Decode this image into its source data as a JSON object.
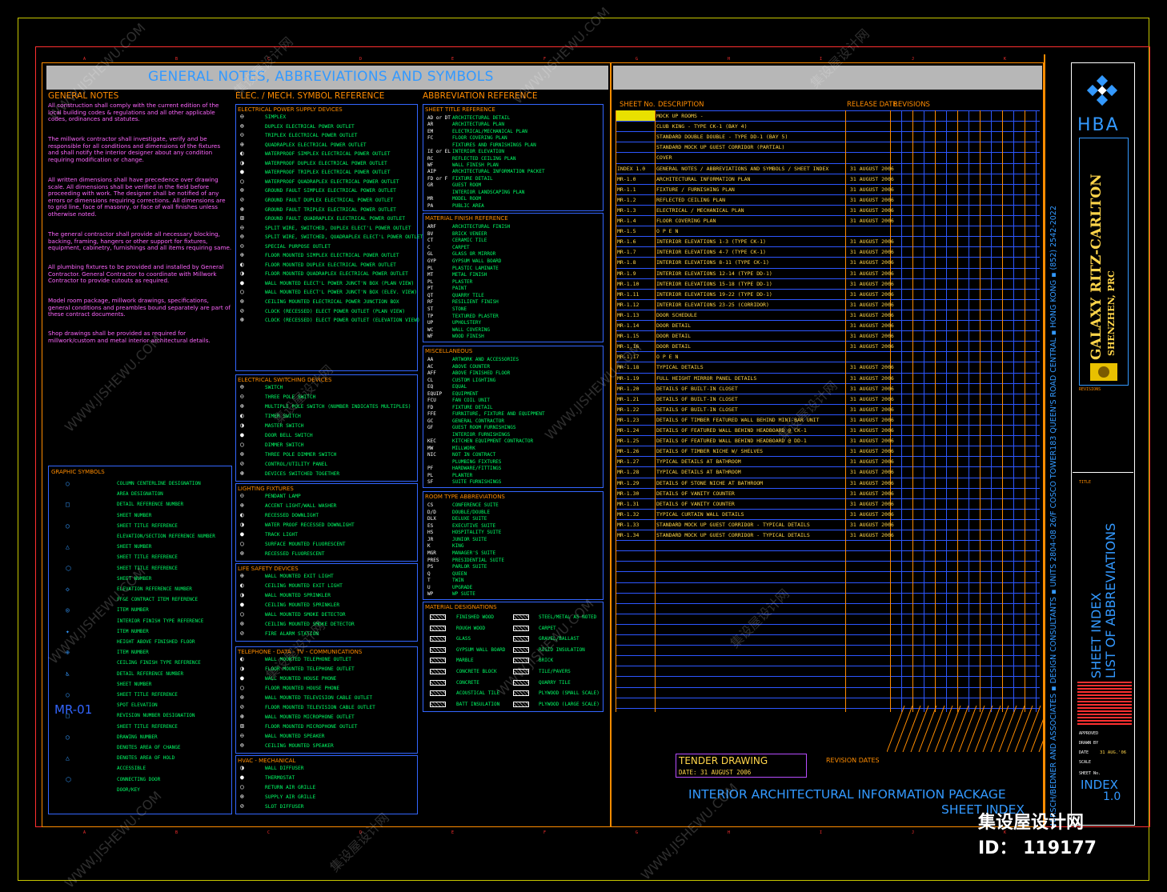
{
  "titles": {
    "main": "GENERAL NOTES, ABBREVIATIONS AND SYMBOLS",
    "general_notes": "GENERAL NOTES",
    "elec_mech": "ELEC. / MECH. SYMBOL REFERENCE",
    "abbrev": "ABBREVIATION REFERENCE",
    "graphic_symbols": "GRAPHIC SYMBOLS"
  },
  "general_notes": [
    "All construction shall comply with the current edition of the local building codes & regulations and all other applicable codes, ordinances and statutes.",
    "The millwork contractor shall investigate, verify and be responsible for all conditions and dimensions of the fixtures and shall notify the interior designer about any condition requiring modification or change.",
    "All written dimensions shall have precedence over drawing scale. All dimensions shall be verified in the field before proceeding with work. The designer shall be notified of any errors or dimensions requiring corrections. All dimensions are to grid line, face of masonry, or face of wall finishes unless otherwise noted.",
    "The general contractor shall provide all necessary blocking, backing, framing, hangers or other support for fixtures, equipment, cabinetry, furnishings and all items requiring same.",
    "All plumbing fixtures to be provided and installed by General Contractor. General Contractor to coordinate with Millwork Contractor to provide cutouts as required.",
    "Model room package, millwork drawings, specifications, general conditions and preambles bound separately are part of these contract documents.",
    "Shop drawings shall be provided as required for millwork/custom and metal interior architectural details."
  ],
  "elec_sections": [
    {
      "title": "ELECTRICAL POWER SUPPLY DEVICES",
      "items": [
        "SIMPLEX",
        "DUPLEX ELECTRICAL POWER OUTLET",
        "TRIPLEX ELECTRICAL POWER OUTLET",
        "QUADRAPLEX ELECTRICAL POWER OUTLET",
        "WATERPROOF SIMPLEX ELECTRICAL POWER OUTLET",
        "WATERPROOF DUPLEX ELECTRICAL POWER OUTLET",
        "WATERPROOF TRIPLEX ELECTRICAL POWER OUTLET",
        "WATERPROOF QUADRAPLEX ELECTRICAL POWER OUTLET",
        "GROUND FAULT SIMPLEX ELECTRICAL POWER OUTLET",
        "GROUND FAULT DUPLEX ELECTRICAL POWER OUTLET",
        "GROUND FAULT TRIPLEX ELECTRICAL POWER OUTLET",
        "GROUND FAULT QUADRAPLEX ELECTRICAL POWER OUTLET",
        "SPLIT WIRE, SWITCHED, DUPLEX ELECT'L POWER OUTLET",
        "SPLIT WIRE, SWITCHED, QUADRAPLEX ELECT'L POWER OUTLET",
        "SPECIAL PURPOSE OUTLET",
        "FLOOR MOUNTED SIMPLEX ELECTRICAL POWER OUTLET",
        "FLOOR MOUNTED DUPLEX ELECTRICAL POWER OUTLET",
        "FLOOR MOUNTED QUADRAPLEX ELECTRICAL POWER OUTLET",
        "WALL MOUNTED ELECT'L POWER JUNCT'N BOX (PLAN VIEW)",
        "WALL MOUNTED ELECT'L POWER JUNCT'N BOX (ELEV. VIEW)",
        "CEILING MOUNTED ELECTRICAL POWER JUNCTION BOX",
        "CLOCK (RECESSED) ELECT POWER OUTLET (PLAN VIEW)",
        "CLOCK (RECESSED) ELECT POWER OUTLET (ELEVATION VIEW)"
      ]
    },
    {
      "title": "ELECTRICAL SWITCHING DEVICES",
      "items": [
        "SWITCH",
        "THREE POLE SWITCH",
        "MULTIPLE POLE SWITCH (NUMBER INDICATES MULTIPLES)",
        "TIMER SWITCH",
        "MASTER SWITCH",
        "DOOR BELL SWITCH",
        "DIMMER SWITCH",
        "THREE POLE DIMMER SWITCH",
        "CONTROL/UTILITY PANEL",
        "DEVICES SWITCHED TOGETHER"
      ]
    },
    {
      "title": "LIGHTING FIXTURES",
      "items": [
        "PENDANT LAMP",
        "ACCENT LIGHT/WALL WASHER",
        "RECESSED DOWNLIGHT",
        "WATER PROOF RECESSED DOWNLIGHT",
        "TRACK LIGHT",
        "SURFACE MOUNTED FLUORESCENT",
        "RECESSED FLUORESCENT"
      ]
    },
    {
      "title": "LIFE SAFETY DEVICES",
      "items": [
        "WALL MOUNTED EXIT LIGHT",
        "CEILING MOUNTED EXIT LIGHT",
        "WALL MOUNTED SPRINKLER",
        "CEILING MOUNTED SPRINKLER",
        "WALL MOUNTED SMOKE DETECTOR",
        "CEILING MOUNTED SMOKE DETECTOR",
        "FIRE ALARM STATION"
      ]
    },
    {
      "title": "TELEPHONE - DATA - TV - COMMUNICATIONS",
      "items": [
        "WALL MOUNTED TELEPHONE OUTLET",
        "FLOOR MOUNTED TELEPHONE OUTLET",
        "WALL MOUNTED HOUSE PHONE",
        "FLOOR MOUNTED HOUSE PHONE",
        "WALL MOUNTED TELEVISION CABLE OUTLET",
        "FLOOR MOUNTED TELEVISION CABLE OUTLET",
        "WALL MOUNTED MICROPHONE OUTLET",
        "FLOOR MOUNTED MICROPHONE OUTLET",
        "WALL MOUNTED SPEAKER",
        "CEILING MOUNTED SPEAKER"
      ]
    },
    {
      "title": "HVAC - MECHANICAL",
      "items": [
        "WALL DIFFUSER",
        "THERMOSTAT",
        "RETURN AIR GRILLE",
        "SUPPLY AIR GRILLE",
        "SLOT DIFFUSER"
      ]
    }
  ],
  "abbr_sections": [
    {
      "title": "SHEET TITLE REFERENCE",
      "items": [
        [
          "AD or DT",
          "ARCHITECTURAL DETAIL"
        ],
        [
          "AR",
          "ARCHITECTURAL PLAN"
        ],
        [
          "EM",
          "ELECTRICAL/MECHANICAL PLAN"
        ],
        [
          "FC",
          "FLOOR COVERING PLAN"
        ],
        [
          "",
          "FIXTURES AND FURNISHINGS PLAN"
        ],
        [
          "IE or EL",
          "INTERIOR ELEVATION"
        ],
        [
          "RC",
          "REFLECTED CEILING PLAN"
        ],
        [
          "WF",
          "WALL FINISH PLAN"
        ],
        [
          "AIP",
          "ARCHITECTURAL INFORMATION PACKET"
        ],
        [
          "FD or F",
          "FIXTURE DETAIL"
        ],
        [
          "GR",
          "GUEST ROOM"
        ],
        [
          "",
          "INTERIOR LANDSCAPING PLAN"
        ],
        [
          "MR",
          "MODEL ROOM"
        ],
        [
          "PA",
          "PUBLIC AREA"
        ]
      ]
    },
    {
      "title": "MATERIAL FINISH REFERENCE",
      "items": [
        [
          "ARF",
          "ARCHITECTURAL FINISH"
        ],
        [
          "BV",
          "BRICK VENEER"
        ],
        [
          "CT",
          "CERAMIC TILE"
        ],
        [
          "C",
          "CARPET"
        ],
        [
          "GL",
          "GLASS OR MIRROR"
        ],
        [
          "GYP",
          "GYPSUM WALL BOARD"
        ],
        [
          "PL",
          "PLASTIC LAMINATE"
        ],
        [
          "MT",
          "METAL FINISH"
        ],
        [
          "PL",
          "PLASTER"
        ],
        [
          "PT",
          "PAINT"
        ],
        [
          "QT",
          "QUARRY TILE"
        ],
        [
          "RF",
          "RESILIENT FINISH"
        ],
        [
          "ST",
          "STONE"
        ],
        [
          "TP",
          "TEXTURED PLASTER"
        ],
        [
          "UP",
          "UPHOLSTERY"
        ],
        [
          "WC",
          "WALL COVERING"
        ],
        [
          "WF",
          "WOOD FINISH"
        ]
      ]
    },
    {
      "title": "MISCELLANEOUS",
      "items": [
        [
          "AA",
          "ARTWORK AND ACCESSORIES"
        ],
        [
          "AC",
          "ABOVE COUNTER"
        ],
        [
          "AFF",
          "ABOVE FINISHED FLOOR"
        ],
        [
          "CL",
          "CUSTOM LIGHTING"
        ],
        [
          "EQ",
          "EQUAL"
        ],
        [
          "EQUIP",
          "EQUIPMENT"
        ],
        [
          "FCU",
          "FAN COIL UNIT"
        ],
        [
          "FD",
          "FIXTURE DETAIL"
        ],
        [
          "FFE",
          "FURNITURE, FIXTURE AND EQUIPMENT"
        ],
        [
          "GC",
          "GENERAL CONTRACTOR"
        ],
        [
          "GF",
          "GUEST ROOM FURNISHINGS"
        ],
        [
          "",
          "INTERIOR FURNISHINGS"
        ],
        [
          "KEC",
          "KITCHEN EQUIPMENT CONTRACTOR"
        ],
        [
          "MW",
          "MILLWORK"
        ],
        [
          "NIC",
          "NOT IN CONTRACT"
        ],
        [
          "",
          "PLUMBING FIXTURES"
        ],
        [
          "PF",
          "HARDWARE/FITTINGS"
        ],
        [
          "PL",
          "PLANTER"
        ],
        [
          "SF",
          "SUITE FURNISHINGS"
        ]
      ]
    },
    {
      "title": "ROOM TYPE ABBREVIATIONS",
      "items": [
        [
          "CS",
          "CONFERENCE SUITE"
        ],
        [
          "D/D",
          "DOUBLE/DOUBLE"
        ],
        [
          "DLX",
          "DELUXE SUITE"
        ],
        [
          "ES",
          "EXECUTIVE SUITE"
        ],
        [
          "HS",
          "HOSPITALITY SUITE"
        ],
        [
          "JR",
          "JUNIOR SUITE"
        ],
        [
          "K",
          "KING"
        ],
        [
          "MGR",
          "MANAGER'S SUITE"
        ],
        [
          "PRES",
          "PRESIDENTIAL SUITE"
        ],
        [
          "PS",
          "PARLOR SUITE"
        ],
        [
          "Q",
          "QUEEN"
        ],
        [
          "T",
          "TWIN"
        ],
        [
          "U",
          "UPGRADE"
        ],
        [
          "WP",
          "WP SUITE"
        ]
      ]
    }
  ],
  "material_designations": {
    "title": "MATERIAL DESIGNATIONS",
    "left": [
      "FINISHED WOOD",
      "ROUGH WOOD",
      "GLASS",
      "GYPSUM WALL BOARD",
      "MARBLE",
      "CONCRETE BLOCK",
      "CONCRETE",
      "ACOUSTICAL TILE",
      "BATT INSULATION"
    ],
    "right": [
      "STEEL/METAL AS NOTED",
      "CARPET",
      "GRAVEL/BALLAST",
      "RIGID INSULATION",
      "BRICK",
      "TILE/PAVERS",
      "QUARRY TILE",
      "PLYWOOD (SMALL SCALE)",
      "PLYWOOD (LARGE SCALE)"
    ]
  },
  "graphic_symbols": [
    "COLUMN CENTERLINE DESIGNATION",
    "AREA DESIGNATION",
    "DETAIL REFERENCE NUMBER",
    "SHEET NUMBER",
    "SHEET TITLE REFERENCE",
    "ELEVATION/SECTION REFERENCE NUMBER",
    "SHEET NUMBER",
    "SHEET TITLE REFERENCE",
    "SHEET TITLE REFERENCE",
    "SHEET NUMBER",
    "ELEVATION REFERENCE NUMBER",
    "FF&E CONTRACT ITEM REFERENCE",
    "ITEM NUMBER",
    "INTERIOR FINISH TYPE REFERENCE",
    "ITEM NUMBER",
    "HEIGHT ABOVE FINISHED FLOOR",
    "ITEM NUMBER",
    "CEILING FINISH TYPE REFERENCE",
    "DETAIL REFERENCE NUMBER",
    "SHEET NUMBER",
    "SHEET TITLE REFERENCE",
    "SPOT ELEVATION",
    "REVISION NUMBER DESIGNATION",
    "SHEET TITLE REFERENCE",
    "DRAWING NUMBER",
    "DENOTES AREA OF CHANGE",
    "DENOTES AREA OF HOLD",
    "ACCESSIBLE",
    "CONNECTING DOOR",
    "DOOR/KEY"
  ],
  "drawing_label": "MR-01",
  "sheet_index": {
    "headers": {
      "no": "SHEET No.",
      "desc": "DESCRIPTION",
      "release": "RELEASE DATE",
      "revisions": "REVISIONS"
    },
    "rows": [
      [
        "",
        "MOCK UP ROOMS -",
        ""
      ],
      [
        "",
        "CLUB KING - TYPE CK-1 (BAY 4)",
        ""
      ],
      [
        "",
        "STANDARD DOUBLE DOUBLE - TYPE DD-1 (BAY 5)",
        ""
      ],
      [
        "",
        "STANDARD MOCK UP GUEST CORRIDOR (PARTIAL)",
        ""
      ],
      [
        "",
        "COVER",
        ""
      ],
      [
        "INDEX 1.0",
        "GENERAL NOTES / ABBREVIATIONS AND SYMBOLS / SHEET INDEX",
        "31 AUGUST 2006"
      ],
      [
        "MR-1.0",
        "ARCHITECTURAL INFORMATION PLAN",
        "31 AUGUST 2006"
      ],
      [
        "MR-1.1",
        "FIXTURE / FURNISHING PLAN",
        "31 AUGUST 2006"
      ],
      [
        "MR-1.2",
        "REFLECTED CEILING PLAN",
        "31 AUGUST 2006"
      ],
      [
        "MR-1.3",
        "ELECTRICAL / MECHANICAL PLAN",
        "31 AUGUST 2006"
      ],
      [
        "MR-1.4",
        "FLOOR COVERING PLAN",
        "31 AUGUST 2006"
      ],
      [
        "MR-1.5",
        "O P E N",
        ""
      ],
      [
        "MR-1.6",
        "INTERIOR ELEVATIONS 1-3 (TYPE CK-1)",
        "31 AUGUST 2006"
      ],
      [
        "MR-1.7",
        "INTERIOR ELEVATIONS 4-7 (TYPE CK-1)",
        "31 AUGUST 2006"
      ],
      [
        "MR-1.8",
        "INTERIOR ELEVATIONS 8-11 (TYPE CK-1)",
        "31 AUGUST 2006"
      ],
      [
        "MR-1.9",
        "INTERIOR ELEVATIONS 12-14 (TYPE DD-1)",
        "31 AUGUST 2006"
      ],
      [
        "MR-1.10",
        "INTERIOR ELEVATIONS 15-18 (TYPE DD-1)",
        "31 AUGUST 2006"
      ],
      [
        "MR-1.11",
        "INTERIOR ELEVATIONS 19-22 (TYPE DD-1)",
        "31 AUGUST 2006"
      ],
      [
        "MR-1.12",
        "INTERIOR ELEVATIONS 23-25 (CORRIDOR)",
        "31 AUGUST 2006"
      ],
      [
        "MR-1.13",
        "DOOR SCHEDULE",
        "31 AUGUST 2006"
      ],
      [
        "MR-1.14",
        "DOOR DETAIL",
        "31 AUGUST 2006"
      ],
      [
        "MR-1.15",
        "DOOR DETAIL",
        "31 AUGUST 2006"
      ],
      [
        "MR-1.16",
        "DOOR DETAIL",
        "31 AUGUST 2006"
      ],
      [
        "MR-1.17",
        "O P E N",
        ""
      ],
      [
        "MR-1.18",
        "TYPICAL DETAILS",
        "31 AUGUST 2006"
      ],
      [
        "MR-1.19",
        "FULL HEIGHT MIRROR PANEL DETAILS",
        "31 AUGUST 2006"
      ],
      [
        "MR-1.20",
        "DETAILS OF BUILT-IN CLOSET",
        "31 AUGUST 2006"
      ],
      [
        "MR-1.21",
        "DETAILS OF BUILT-IN CLOSET",
        "31 AUGUST 2006"
      ],
      [
        "MR-1.22",
        "DETAILS OF BUILT-IN CLOSET",
        "31 AUGUST 2006"
      ],
      [
        "MR-1.23",
        "DETAILS OF TIMBER FEATURED WALL BEHIND MINI-BAR UNIT",
        "31 AUGUST 2006"
      ],
      [
        "MR-1.24",
        "DETAILS OF FEATURED WALL BEHIND HEADBOARD @ CK-1",
        "31 AUGUST 2006"
      ],
      [
        "MR-1.25",
        "DETAILS OF FEATURED WALL BEHIND HEADBOARD @ DD-1",
        "31 AUGUST 2006"
      ],
      [
        "MR-1.26",
        "DETAILS OF TIMBER NICHE W/ SHELVES",
        "31 AUGUST 2006"
      ],
      [
        "MR-1.27",
        "TYPICAL DETAILS AT BATHROOM",
        "31 AUGUST 2006"
      ],
      [
        "MR-1.28",
        "TYPICAL DETAILS AT BATHROOM",
        "31 AUGUST 2006"
      ],
      [
        "MR-1.29",
        "DETAILS OF STONE NICHE AT BATHROOM",
        "31 AUGUST 2006"
      ],
      [
        "MR-1.30",
        "DETAILS OF VANITY COUNTER",
        "31 AUGUST 2006"
      ],
      [
        "MR-1.31",
        "DETAILS OF VANITY COUNTER",
        "31 AUGUST 2006"
      ],
      [
        "MR-1.32",
        "TYPICAL CURTAIN WALL DETAILS",
        "31 AUGUST 2006"
      ],
      [
        "MR-1.33",
        "STANDARD MOCK UP GUEST CORRIDOR - TYPICAL DETAILS",
        "31 AUGUST 2006"
      ],
      [
        "MR-1.34",
        "STANDARD MOCK UP GUEST CORRIDOR - TYPICAL DETAILS",
        "31 AUGUST 2006"
      ]
    ]
  },
  "tender": {
    "label": "TENDER DRAWING",
    "date": "DATE: 31 AUGUST 2006",
    "revision_dates": "REVISION DATES"
  },
  "package_title": "INTERIOR ARCHITECTURAL INFORMATION PACKAGE",
  "package_sub": "SHEET INDEX",
  "address_strip": "HIRSCH/BEDNER AND ASSOCIATES  ▪  DESIGN CONSULTANTS  ▪  UNITS 2804-08  26/F COSCO TOWER183  QUEEN'S ROAD CENTRAL  ▪  HONG KONG  ▪  (852) 2542-2022",
  "title_block": {
    "firm": "HBA",
    "project": "GALAXY RITZ-CARLTON",
    "location": "SHENZHEN, PRC",
    "revisions_label": "REVISIONS",
    "title_label": "TITLE",
    "sheet_title_1": "SHEET INDEX",
    "sheet_title_2": "LIST OF ABBREVIATIONS",
    "approved": "APPROVED",
    "drawn_by": "DRAWN BY",
    "date_label": "DATE",
    "date_value": "31 AUG.'06",
    "scale_label": "SCALE",
    "sheet_no_label": "SHEET No.",
    "sheet_no": "INDEX",
    "sheet_no_num": "1.0"
  },
  "watermark": {
    "site": "集设屋设计网",
    "id": "ID： 119177",
    "url": "WWW.JISHEWU.COM"
  },
  "colors": {
    "accent_blue": "#3399ff",
    "orange": "#ff8c00",
    "green": "#00ff66",
    "yellow": "#ffd54a",
    "red": "#ff3030",
    "title_bg": "#b7b7b7"
  }
}
